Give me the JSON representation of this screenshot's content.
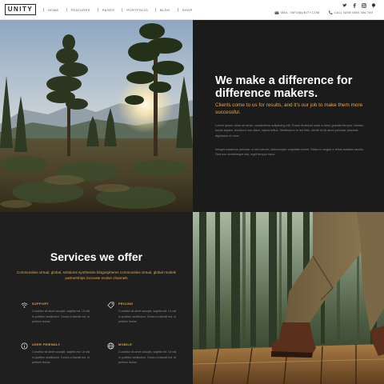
{
  "header": {
    "logo": "UNITY",
    "nav": [
      "HOME",
      "FEATURES",
      "PAGES",
      "PORTFOLIO",
      "BLOG",
      "SHOP"
    ],
    "social_icons": [
      "twitter-icon",
      "facebook-icon",
      "instagram-icon",
      "pinterest-icon"
    ],
    "email": "MAIL: INFO@UNITY.COM",
    "phone": "CALL NOW 0800 456 789"
  },
  "hero": {
    "title": "We make a difference for difference makers.",
    "subtitle": "Clients come to us for results, and it's our job to make them more successful.",
    "paragraph1": "Lorem ipsum dolor sit amet, consectetur adipiscing elit. Fusce tincidunt nulla a dolor gravida tempor. Nullam turpis sapien, tincidunt non diam, varius tellus. Vestibulum in leo felis. Morbi id sit amet pulvinar placerat, dignissim et urna.",
    "paragraph2": "Integer maximus pulvinar ut nisl rutrum, ullamcorper vulputate lorem. Etiam in augue a tellus sodales iaculis. Sed non scelerisque nisi, eget tempor risus."
  },
  "services": {
    "title": "Services we offer",
    "subtitle": "Communities virtual, global, solutions synthesize blogospheres communities virtual, global models partnerships innovate evolve channels",
    "features": [
      {
        "title": "SUPPORT",
        "icon": "wifi-icon",
        "text": "Curabitur sit amet suscipit, sagittis est. Ut nisl in porttitor vestibulum. Donec a blandit est, id pretium lectus."
      },
      {
        "title": "PRICING",
        "icon": "tag-icon",
        "text": "Curabitur sit amet suscipit, sagittis est. Ut nisl in porttitor vestibulum. Donec a blandit est, id pretium lectus."
      },
      {
        "title": "USER FRIENDLY",
        "icon": "info-icon",
        "text": "Curabitur sit amet suscipit, sagittis est. Ut nisl in porttitor vestibulum. Donec a blandit est, id pretium lectus."
      },
      {
        "title": "MOBILE",
        "icon": "globe-icon",
        "text": "Curabitur sit amet suscipit, sagittis est. Ut nisl in porttitor vestibulum. Donec a blandit est, id pretium lectus."
      }
    ]
  },
  "colors": {
    "accent": "#e8a64a",
    "dark_panel": "#1b1b1b",
    "header_bg": "#ffffff"
  }
}
